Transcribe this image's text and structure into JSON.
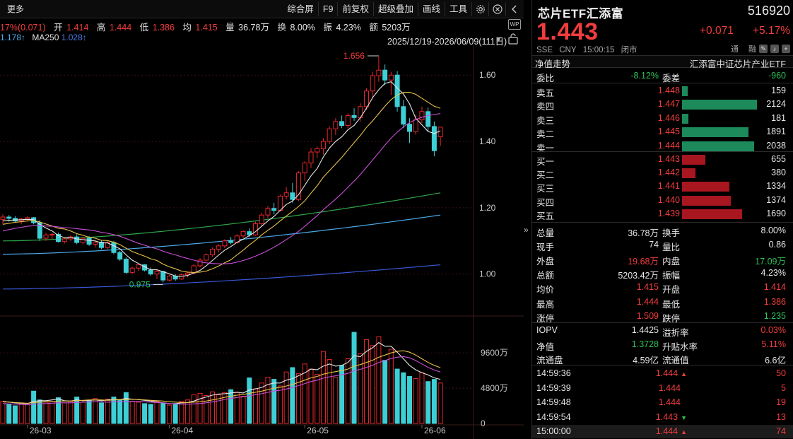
{
  "toolbar": {
    "more_label": "更多",
    "items": [
      "综合屏",
      "F9",
      "前复权",
      "超级叠加",
      "画线",
      "工具"
    ]
  },
  "quote_row": {
    "change_text": "17%(0.071)",
    "open_label": "开",
    "open": "1.414",
    "high_label": "高",
    "high": "1.444",
    "low_label": "低",
    "low": "1.386",
    "avg_label": "均",
    "avg": "1.415",
    "vol_label": "量",
    "vol": "36.78万",
    "turnover_label": "换",
    "turnover": "8.00%",
    "amp_label": "振",
    "amp": "4.23%",
    "amount_label": "额",
    "amount": "5203万"
  },
  "ma_row": {
    "ma_prev_value": "1.178",
    "ma_prev_arrow": "↑",
    "ma250_label": "MA250",
    "ma250_value": "1.028",
    "ma250_arrow": "↑"
  },
  "date_range": "2025/12/19-2026/06/09(111日)",
  "wp_label": "WP",
  "chart_data": {
    "type": "candlestick",
    "price_axis": {
      "ticks": [
        1.6,
        1.4,
        1.2,
        1.0
      ],
      "tick_labels": [
        "1.60",
        "1.40",
        "1.20",
        "1.00"
      ],
      "ylim": [
        0.88,
        1.69
      ]
    },
    "volume_axis": {
      "tick_labels": [
        "9600万",
        "4800万",
        "0"
      ],
      "ylim": [
        0,
        12600
      ]
    },
    "x_labels": [
      "26-03",
      "26-04",
      "26-05",
      "26-06"
    ],
    "annotations": {
      "high_label": "1.656",
      "low_label": "0.975"
    },
    "candles": [
      {
        "o": 1.165,
        "h": 1.18,
        "l": 1.15,
        "c": 1.172
      },
      {
        "o": 1.172,
        "h": 1.178,
        "l": 1.158,
        "c": 1.168
      },
      {
        "o": 1.168,
        "h": 1.175,
        "l": 1.155,
        "c": 1.16
      },
      {
        "o": 1.16,
        "h": 1.17,
        "l": 1.15,
        "c": 1.166
      },
      {
        "o": 1.166,
        "h": 1.175,
        "l": 1.16,
        "c": 1.17
      },
      {
        "o": 1.17,
        "h": 1.172,
        "l": 1.15,
        "c": 1.155
      },
      {
        "o": 1.155,
        "h": 1.162,
        "l": 1.1,
        "c": 1.108
      },
      {
        "o": 1.108,
        "h": 1.125,
        "l": 1.1,
        "c": 1.118
      },
      {
        "o": 1.118,
        "h": 1.125,
        "l": 1.105,
        "c": 1.12
      },
      {
        "o": 1.12,
        "h": 1.125,
        "l": 1.095,
        "c": 1.098
      },
      {
        "o": 1.098,
        "h": 1.11,
        "l": 1.092,
        "c": 1.106
      },
      {
        "o": 1.106,
        "h": 1.118,
        "l": 1.1,
        "c": 1.112
      },
      {
        "o": 1.112,
        "h": 1.12,
        "l": 1.09,
        "c": 1.095
      },
      {
        "o": 1.095,
        "h": 1.112,
        "l": 1.09,
        "c": 1.108
      },
      {
        "o": 1.108,
        "h": 1.115,
        "l": 1.085,
        "c": 1.09
      },
      {
        "o": 1.09,
        "h": 1.1,
        "l": 1.08,
        "c": 1.096
      },
      {
        "o": 1.096,
        "h": 1.102,
        "l": 1.075,
        "c": 1.08
      },
      {
        "o": 1.08,
        "h": 1.1,
        "l": 1.075,
        "c": 1.095
      },
      {
        "o": 1.095,
        "h": 1.1,
        "l": 1.06,
        "c": 1.065
      },
      {
        "o": 1.065,
        "h": 1.07,
        "l": 1.04,
        "c": 1.045
      },
      {
        "o": 1.045,
        "h": 1.05,
        "l": 1.0,
        "c": 1.005
      },
      {
        "o": 1.005,
        "h": 1.022,
        "l": 1.0,
        "c": 1.018
      },
      {
        "o": 1.018,
        "h": 1.03,
        "l": 1.01,
        "c": 1.028
      },
      {
        "o": 1.028,
        "h": 1.03,
        "l": 1.008,
        "c": 1.012
      },
      {
        "o": 1.012,
        "h": 1.02,
        "l": 0.995,
        "c": 1.0
      },
      {
        "o": 1.0,
        "h": 1.012,
        "l": 0.985,
        "c": 1.008
      },
      {
        "o": 1.008,
        "h": 1.01,
        "l": 0.975,
        "c": 0.982
      },
      {
        "o": 0.982,
        "h": 0.998,
        "l": 0.978,
        "c": 0.994
      },
      {
        "o": 0.994,
        "h": 1.0,
        "l": 0.98,
        "c": 0.985
      },
      {
        "o": 0.985,
        "h": 1.002,
        "l": 0.982,
        "c": 0.998
      },
      {
        "o": 0.998,
        "h": 1.005,
        "l": 0.99,
        "c": 1.003
      },
      {
        "o": 1.003,
        "h": 1.03,
        "l": 1.0,
        "c": 1.025
      },
      {
        "o": 1.025,
        "h": 1.048,
        "l": 1.02,
        "c": 1.042
      },
      {
        "o": 1.042,
        "h": 1.062,
        "l": 1.038,
        "c": 1.058
      },
      {
        "o": 1.058,
        "h": 1.08,
        "l": 1.052,
        "c": 1.075
      },
      {
        "o": 1.075,
        "h": 1.09,
        "l": 1.065,
        "c": 1.085
      },
      {
        "o": 1.085,
        "h": 1.105,
        "l": 1.078,
        "c": 1.1
      },
      {
        "o": 1.1,
        "h": 1.112,
        "l": 1.09,
        "c": 1.095
      },
      {
        "o": 1.095,
        "h": 1.12,
        "l": 1.092,
        "c": 1.115
      },
      {
        "o": 1.115,
        "h": 1.132,
        "l": 1.108,
        "c": 1.128
      },
      {
        "o": 1.128,
        "h": 1.138,
        "l": 1.112,
        "c": 1.118
      },
      {
        "o": 1.118,
        "h": 1.158,
        "l": 1.115,
        "c": 1.152
      },
      {
        "o": 1.152,
        "h": 1.185,
        "l": 1.145,
        "c": 1.178
      },
      {
        "o": 1.178,
        "h": 1.205,
        "l": 1.168,
        "c": 1.198
      },
      {
        "o": 1.198,
        "h": 1.215,
        "l": 1.18,
        "c": 1.192
      },
      {
        "o": 1.192,
        "h": 1.24,
        "l": 1.188,
        "c": 1.235
      },
      {
        "o": 1.235,
        "h": 1.262,
        "l": 1.225,
        "c": 1.245
      },
      {
        "o": 1.245,
        "h": 1.275,
        "l": 1.215,
        "c": 1.225
      },
      {
        "o": 1.225,
        "h": 1.31,
        "l": 1.22,
        "c": 1.305
      },
      {
        "o": 1.305,
        "h": 1.34,
        "l": 1.28,
        "c": 1.335
      },
      {
        "o": 1.335,
        "h": 1.38,
        "l": 1.32,
        "c": 1.368
      },
      {
        "o": 1.368,
        "h": 1.385,
        "l": 1.35,
        "c": 1.378
      },
      {
        "o": 1.378,
        "h": 1.41,
        "l": 1.36,
        "c": 1.4
      },
      {
        "o": 1.4,
        "h": 1.445,
        "l": 1.392,
        "c": 1.438
      },
      {
        "o": 1.438,
        "h": 1.47,
        "l": 1.42,
        "c": 1.46
      },
      {
        "o": 1.46,
        "h": 1.478,
        "l": 1.44,
        "c": 1.448
      },
      {
        "o": 1.448,
        "h": 1.485,
        "l": 1.44,
        "c": 1.478
      },
      {
        "o": 1.478,
        "h": 1.5,
        "l": 1.462,
        "c": 1.472
      },
      {
        "o": 1.472,
        "h": 1.515,
        "l": 1.46,
        "c": 1.505
      },
      {
        "o": 1.505,
        "h": 1.56,
        "l": 1.495,
        "c": 1.552
      },
      {
        "o": 1.552,
        "h": 1.61,
        "l": 1.53,
        "c": 1.598
      },
      {
        "o": 1.598,
        "h": 1.656,
        "l": 1.58,
        "c": 1.615
      },
      {
        "o": 1.615,
        "h": 1.632,
        "l": 1.57,
        "c": 1.585
      },
      {
        "o": 1.585,
        "h": 1.61,
        "l": 1.54,
        "c": 1.6
      },
      {
        "o": 1.6,
        "h": 1.612,
        "l": 1.49,
        "c": 1.505
      },
      {
        "o": 1.505,
        "h": 1.525,
        "l": 1.44,
        "c": 1.452
      },
      {
        "o": 1.452,
        "h": 1.47,
        "l": 1.395,
        "c": 1.43
      },
      {
        "o": 1.43,
        "h": 1.48,
        "l": 1.42,
        "c": 1.465
      },
      {
        "o": 1.465,
        "h": 1.505,
        "l": 1.455,
        "c": 1.49
      },
      {
        "o": 1.49,
        "h": 1.502,
        "l": 1.43,
        "c": 1.445
      },
      {
        "o": 1.445,
        "h": 1.46,
        "l": 1.355,
        "c": 1.372
      },
      {
        "o": 1.414,
        "h": 1.444,
        "l": 1.386,
        "c": 1.443
      }
    ],
    "volumes": [
      3000,
      2600,
      2400,
      2800,
      2700,
      4400,
      3200,
      2900,
      3000,
      3500,
      2800,
      3000,
      3600,
      2900,
      3100,
      3400,
      2800,
      3300,
      3600,
      3200,
      4200,
      3000,
      2900,
      2700,
      2600,
      3000,
      2800,
      2500,
      2700,
      3000,
      3200,
      3900,
      4100,
      3800,
      4300,
      3900,
      4200,
      4600,
      4200,
      3700,
      6200,
      4700,
      5500,
      6300,
      6000,
      5100,
      7000,
      7600,
      6800,
      8100,
      7400,
      6700,
      9800,
      8700,
      6300,
      7900,
      8800,
      12400,
      9500,
      11400,
      10600,
      11800,
      8600,
      10100,
      7400,
      6900,
      6400,
      6100,
      6900,
      5700,
      6000,
      5500
    ],
    "ma_lines": {
      "ma5": [
        1.16,
        1.162,
        1.163,
        1.164,
        1.165,
        1.164,
        1.15,
        1.139,
        1.13,
        1.116,
        1.11,
        1.111,
        1.106,
        1.104,
        1.102,
        1.1,
        1.094,
        1.094,
        1.085,
        1.076,
        1.058,
        1.042,
        1.032,
        1.022,
        1.013,
        1.013,
        1.007,
        1.001,
        0.994,
        0.993,
        0.996,
        1.003,
        1.011,
        1.025,
        1.041,
        1.057,
        1.072,
        1.083,
        1.096,
        1.105,
        1.116,
        1.128,
        1.144,
        1.16,
        1.174,
        1.192,
        1.21,
        1.22,
        1.24,
        1.268,
        1.296,
        1.318,
        1.353,
        1.38,
        1.4,
        1.414,
        1.435,
        1.448,
        1.471,
        1.5,
        1.532,
        1.556,
        1.575,
        1.58,
        1.561,
        1.543,
        1.513,
        1.47,
        1.45,
        1.43,
        1.424,
        1.432
      ],
      "ma10": [
        1.15,
        1.153,
        1.156,
        1.158,
        1.16,
        1.162,
        1.157,
        1.151,
        1.145,
        1.138,
        1.136,
        1.13,
        1.122,
        1.117,
        1.111,
        1.108,
        1.102,
        1.101,
        1.096,
        1.089,
        1.078,
        1.068,
        1.061,
        1.054,
        1.046,
        1.041,
        1.03,
        1.022,
        1.016,
        1.009,
        1.006,
        1.005,
        1.006,
        1.009,
        1.016,
        1.024,
        1.034,
        1.043,
        1.058,
        1.072,
        1.088,
        1.102,
        1.118,
        1.132,
        1.145,
        1.16,
        1.175,
        1.189,
        1.204,
        1.221,
        1.244,
        1.266,
        1.292,
        1.312,
        1.332,
        1.352,
        1.374,
        1.396,
        1.418,
        1.442,
        1.462,
        1.484,
        1.506,
        1.526,
        1.54,
        1.548,
        1.548,
        1.542,
        1.53,
        1.518,
        1.506,
        1.5
      ],
      "ma20": [
        1.13,
        1.134,
        1.138,
        1.141,
        1.144,
        1.146,
        1.146,
        1.145,
        1.144,
        1.142,
        1.14,
        1.139,
        1.137,
        1.135,
        1.133,
        1.13,
        1.126,
        1.123,
        1.119,
        1.114,
        1.107,
        1.1,
        1.093,
        1.087,
        1.081,
        1.076,
        1.069,
        1.063,
        1.058,
        1.052,
        1.047,
        1.042,
        1.037,
        1.034,
        1.032,
        1.031,
        1.031,
        1.032,
        1.036,
        1.041,
        1.047,
        1.054,
        1.062,
        1.071,
        1.081,
        1.092,
        1.104,
        1.116,
        1.129,
        1.144,
        1.16,
        1.176,
        1.194,
        1.21,
        1.226,
        1.243,
        1.262,
        1.28,
        1.3,
        1.322,
        1.344,
        1.366,
        1.389,
        1.41,
        1.428,
        1.444,
        1.457,
        1.466,
        1.473,
        1.478,
        1.481,
        1.484
      ]
    },
    "long_ma_lines": {
      "ma60": {
        "from": 1.1,
        "to": 1.245
      },
      "ma120": {
        "from": 1.06,
        "to": 1.178
      },
      "ma250": {
        "from": 0.955,
        "to": 1.028
      }
    },
    "volume_ma": {
      "ma5": [
        3000,
        2900,
        2800,
        2750,
        2700,
        3000,
        3100,
        3100,
        3200,
        3350,
        3100,
        3050,
        3200,
        3100,
        3150,
        3200,
        3100,
        3200,
        3250,
        3250,
        3400,
        3300,
        3250,
        3150,
        3050,
        2900,
        2800,
        2700,
        2700,
        2800,
        2850,
        3050,
        3350,
        3600,
        3850,
        4000,
        4050,
        4150,
        4250,
        4150,
        4550,
        4700,
        4900,
        5300,
        5500,
        5500,
        5900,
        6100,
        6500,
        6900,
        7400,
        7300,
        7800,
        8100,
        7800,
        7900,
        8300,
        9200,
        9100,
        9800,
        10300,
        11000,
        10500,
        10500,
        9700,
        8800,
        7900,
        7300,
        6900,
        6600,
        6200,
        6000
      ],
      "ma10": [
        2950,
        2900,
        2850,
        2800,
        2750,
        2850,
        2900,
        2950,
        3000,
        3050,
        3050,
        3050,
        3100,
        3150,
        3200,
        3200,
        3200,
        3150,
        3200,
        3250,
        3250,
        3300,
        3250,
        3200,
        3150,
        3100,
        3050,
        2950,
        2900,
        2850,
        2850,
        2900,
        2950,
        3050,
        3200,
        3350,
        3550,
        3700,
        3850,
        3950,
        4100,
        4250,
        4400,
        4600,
        4800,
        4900,
        5100,
        5300,
        5600,
        5900,
        6200,
        6400,
        6700,
        6900,
        7050,
        7200,
        7400,
        7800,
        8000,
        8300,
        8600,
        9000,
        9300,
        9600,
        9800,
        9900,
        9700,
        9300,
        8800,
        8300,
        7900,
        7600
      ]
    }
  },
  "quote_panel": {
    "name": "芯片ETF汇添富",
    "code": "516920",
    "price": "1.443",
    "change": "+0.071",
    "change_pct": "+5.17%",
    "exchange": "SSE",
    "currency": "CNY",
    "time": "15:00:15",
    "status": "闭市",
    "flag_tong": "通",
    "flag_rong": "融",
    "tab_left": "净值走势",
    "tab_right": "汇添富中证芯片产业ETF",
    "commission_ratio_label": "委比",
    "commission_ratio": "-8.12%",
    "commission_diff_label": "委差",
    "commission_diff": "-960",
    "asks": [
      {
        "label": "卖五",
        "price": "1.448",
        "vol": "159",
        "fill": 0.075
      },
      {
        "label": "卖四",
        "price": "1.447",
        "vol": "2124",
        "fill": 1.0
      },
      {
        "label": "卖三",
        "price": "1.446",
        "vol": "181",
        "fill": 0.085
      },
      {
        "label": "卖二",
        "price": "1.445",
        "vol": "1891",
        "fill": 0.89
      },
      {
        "label": "卖一",
        "price": "1.444",
        "vol": "2038",
        "fill": 0.96
      }
    ],
    "bids": [
      {
        "label": "买一",
        "price": "1.443",
        "vol": "655",
        "fill": 0.31
      },
      {
        "label": "买二",
        "price": "1.442",
        "vol": "380",
        "fill": 0.18
      },
      {
        "label": "买三",
        "price": "1.441",
        "vol": "1334",
        "fill": 0.63
      },
      {
        "label": "买四",
        "price": "1.440",
        "vol": "1374",
        "fill": 0.65
      },
      {
        "label": "买五",
        "price": "1.439",
        "vol": "1690",
        "fill": 0.8
      }
    ],
    "stats": [
      {
        "l1": "总量",
        "v1": "36.78万",
        "c1": "wht",
        "l2": "换手",
        "v2": "8.00%",
        "c2": "wht"
      },
      {
        "l1": "现手",
        "v1": "74",
        "c1": "wht",
        "l2": "量比",
        "v2": "0.86",
        "c2": "wht"
      },
      {
        "l1": "外盘",
        "v1": "19.68万",
        "c1": "up",
        "l2": "内盘",
        "v2": "17.09万",
        "c2": "down"
      },
      {
        "l1": "总额",
        "v1": "5203.42万",
        "c1": "wht",
        "l2": "振幅",
        "v2": "4.23%",
        "c2": "wht"
      },
      {
        "l1": "均价",
        "v1": "1.415",
        "c1": "up",
        "l2": "开盘",
        "v2": "1.414",
        "c2": "up"
      },
      {
        "l1": "最高",
        "v1": "1.444",
        "c1": "up",
        "l2": "最低",
        "v2": "1.386",
        "c2": "up"
      },
      {
        "l1": "涨停",
        "v1": "1.509",
        "c1": "up",
        "l2": "跌停",
        "v2": "1.235",
        "c2": "down"
      }
    ],
    "stats2": [
      {
        "l1": "IOPV",
        "v1": "1.4425",
        "c1": "wht",
        "l2": "溢折率",
        "v2": "0.03%",
        "c2": "up"
      },
      {
        "l1": "净值",
        "v1": "1.3728",
        "c1": "down",
        "l2": "升贴水率",
        "v2": "5.11%",
        "c2": "up"
      },
      {
        "l1": "流通盘",
        "v1": "4.59亿",
        "c1": "wht",
        "l2": "流通值",
        "v2": "6.6亿",
        "c2": "wht"
      }
    ],
    "ticks": [
      {
        "time": "14:59:36",
        "price": "1.444",
        "dir": "up",
        "vol": "50"
      },
      {
        "time": "14:59:39",
        "price": "1.444",
        "dir": "",
        "vol": "5"
      },
      {
        "time": "14:59:48",
        "price": "1.444",
        "dir": "",
        "vol": "19"
      },
      {
        "time": "14:59:54",
        "price": "1.443",
        "dir": "down",
        "vol": "13"
      },
      {
        "time": "15:00:00",
        "price": "1.444",
        "dir": "up",
        "vol": "74"
      }
    ]
  },
  "colors": {
    "up": "#f23d3d",
    "down": "#2dbf5a",
    "up_candle": "#e8272d",
    "down_candle": "#3dcfd6",
    "ma5": "#e6e6e6",
    "ma10": "#e8c34a",
    "ma20": "#c74fd6",
    "ma60": "#2fa84a",
    "ma120": "#4aa8e8",
    "ma250": "#3858d8",
    "grid": "#3a1414"
  }
}
